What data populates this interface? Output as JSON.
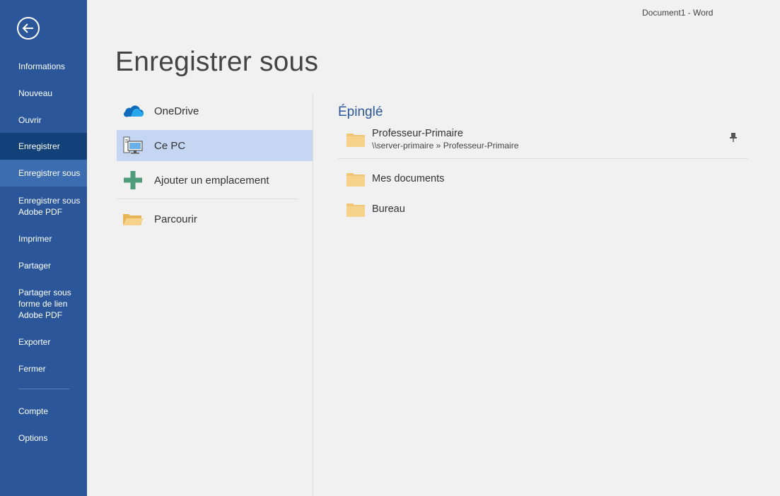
{
  "window": {
    "title": "Document1 - Word"
  },
  "nav": {
    "back_label": "",
    "items": [
      {
        "label": "Informations"
      },
      {
        "label": "Nouveau"
      },
      {
        "label": "Ouvrir"
      },
      {
        "label": "Enregistrer"
      },
      {
        "label": "Enregistrer sous"
      },
      {
        "label": "Enregistrer sous\nAdobe PDF"
      },
      {
        "label": "Imprimer"
      },
      {
        "label": "Partager"
      },
      {
        "label": "Partager sous\nforme de lien\nAdobe PDF"
      },
      {
        "label": "Exporter"
      },
      {
        "label": "Fermer"
      },
      {
        "label": "Compte"
      },
      {
        "label": "Options"
      }
    ],
    "active_item": "Enregistrer sous"
  },
  "page": {
    "title": "Enregistrer sous"
  },
  "locations": [
    {
      "label": "OneDrive",
      "icon": "onedrive-cloud-icon"
    },
    {
      "label": "Ce PC",
      "icon": "computer-icon",
      "selected": true
    },
    {
      "label": "Ajouter un emplacement",
      "icon": "plus-icon"
    },
    {
      "label": "Parcourir",
      "icon": "open-folder-icon"
    }
  ],
  "pinned": {
    "heading": "Épinglé",
    "items": [
      {
        "name": "Professeur-Primaire",
        "path": "\\\\server-primaire » Professeur-Primaire",
        "pinned": true
      }
    ]
  },
  "folders": [
    {
      "name": "Mes documents"
    },
    {
      "name": "Bureau"
    }
  ],
  "colors": {
    "nav_bg": "#2b579a",
    "nav_active": "#3c6db0",
    "nav_dark": "#124078",
    "selected_location": "#c5d6f2",
    "heading_blue": "#2b579a",
    "folder": "#f0c674"
  }
}
